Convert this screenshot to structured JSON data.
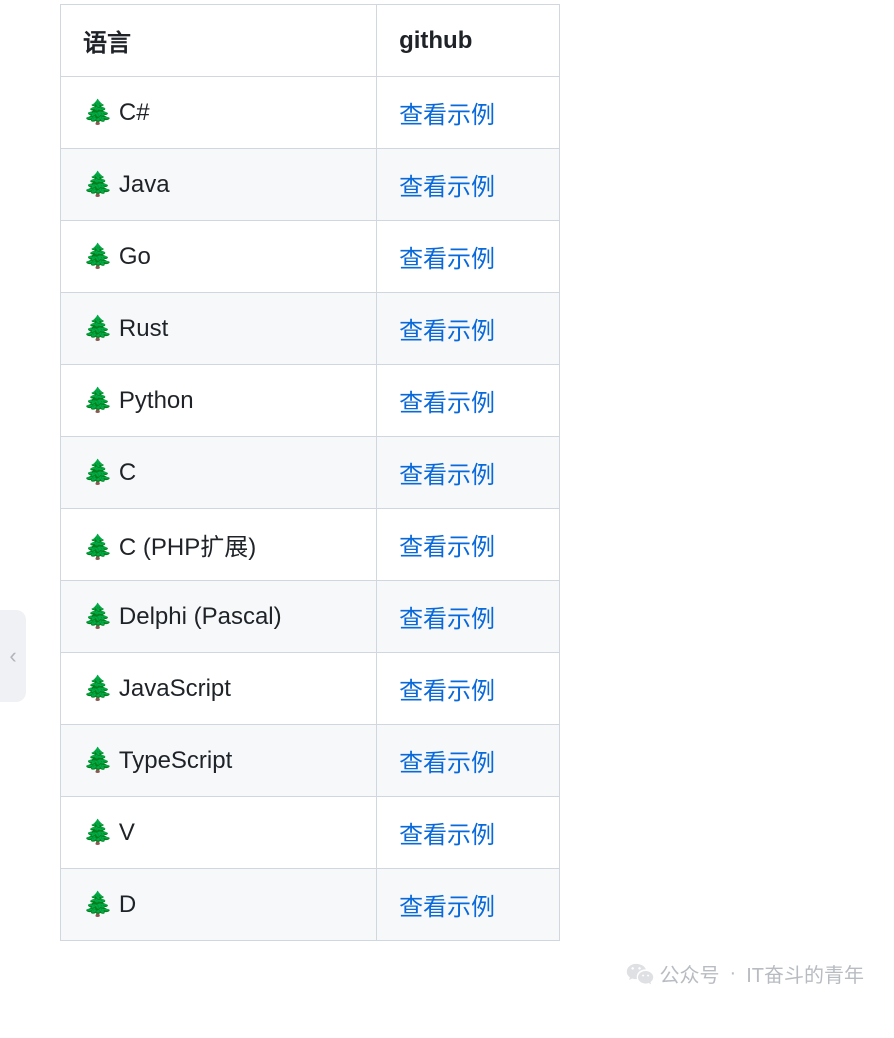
{
  "table": {
    "headers": {
      "col1": "语言",
      "col2": "github"
    },
    "icon": "🌲",
    "link_label": "查看示例",
    "rows": [
      {
        "lang": "C#"
      },
      {
        "lang": "Java"
      },
      {
        "lang": "Go"
      },
      {
        "lang": "Rust"
      },
      {
        "lang": "Python"
      },
      {
        "lang": "C"
      },
      {
        "lang": "C (PHP扩展)"
      },
      {
        "lang": "Delphi (Pascal)"
      },
      {
        "lang": "JavaScript"
      },
      {
        "lang": "TypeScript"
      },
      {
        "lang": "V"
      },
      {
        "lang": "D"
      }
    ]
  },
  "side_tab": {
    "chevron": "‹"
  },
  "watermark": {
    "label": "公众号",
    "dot": "·",
    "name": "IT奋斗的青年"
  }
}
